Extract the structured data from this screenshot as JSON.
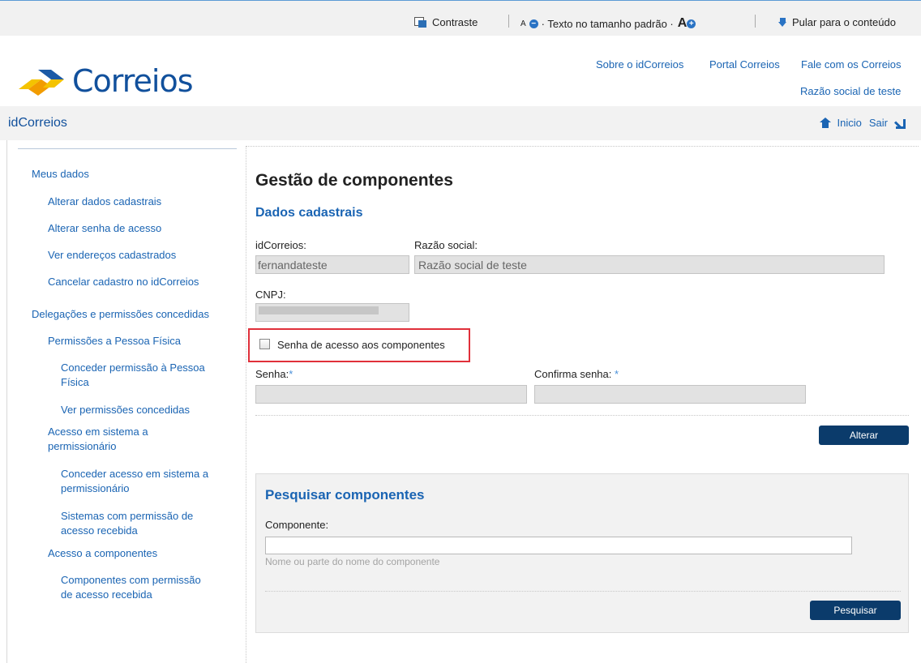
{
  "topbar": {
    "contrast_label": "Contraste",
    "font_size_small": "A",
    "font_size_text": "· Texto no tamanho padrão ·",
    "font_size_big": "A",
    "skip_label": "Pular para o conteúdo"
  },
  "header": {
    "logo_text": "Correios",
    "links": [
      "Sobre o idCorreios",
      "Portal Correios",
      "Fale com os Correios"
    ],
    "company": "Razão social de teste"
  },
  "brandbar": {
    "title": "idCorreios",
    "home_label": "Inicio",
    "exit_label": "Sair"
  },
  "sidebar": {
    "items": [
      "Meus dados",
      "Alterar dados cadastrais",
      "Alterar senha de acesso",
      "Ver endereços cadastrados",
      "Cancelar cadastro no idCorreios",
      "Delegações e permissões concedidas",
      "Permissões a Pessoa Física",
      "Conceder permissão à Pessoa",
      "Física",
      "Ver permissões concedidas",
      "Acesso em sistema a",
      "permissionário",
      "Conceder acesso em sistema a",
      "permissionário",
      "Sistemas com permissão de",
      "acesso recebida",
      "Acesso a componentes",
      "Componentes com permissão",
      "de acesso recebida"
    ]
  },
  "main": {
    "title": "Gestão de componentes",
    "section_title": "Dados cadastrais",
    "idcorreios_label": "idCorreios:",
    "idcorreios_value": "fernandateste",
    "razao_label": "Razão social:",
    "razao_value": "Razão social de teste",
    "cnpj_label": "CNPJ:",
    "checkbox_label": "Senha de acesso aos componentes",
    "senha_label": "Senha:",
    "confirma_label": "Confirma senha:",
    "required_mark": "*",
    "alterar_button": "Alterar"
  },
  "search": {
    "title": "Pesquisar componentes",
    "component_label": "Componente:",
    "component_value": "",
    "hint": "Nome ou parte do nome do componente",
    "button": "Pesquisar"
  },
  "colors": {
    "link": "#1a64b3",
    "brand": "#11509c",
    "button": "#0b3b6b",
    "highlight": "#e0303a"
  }
}
